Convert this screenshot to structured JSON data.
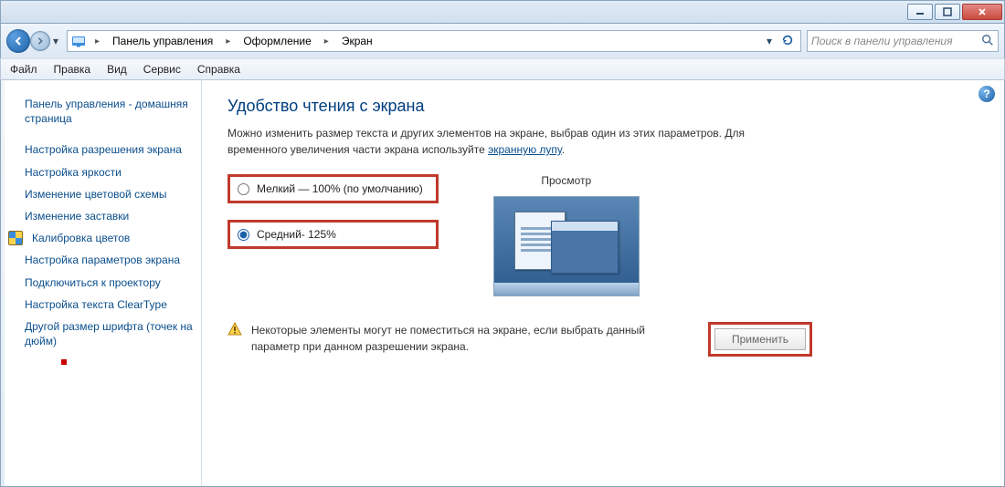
{
  "window": {
    "min_tooltip": "Свернуть",
    "max_tooltip": "Развернуть",
    "close_tooltip": "Закрыть"
  },
  "breadcrumb": {
    "items": [
      "Панель управления",
      "Оформление",
      "Экран"
    ]
  },
  "search": {
    "placeholder": "Поиск в панели управления"
  },
  "menu": {
    "file": "Файл",
    "edit": "Правка",
    "view": "Вид",
    "tools": "Сервис",
    "help": "Справка"
  },
  "sidebar": {
    "items": [
      {
        "label": "Панель управления - домашняя страница",
        "shield": false
      },
      {
        "label": "Настройка разрешения экрана",
        "shield": false
      },
      {
        "label": "Настройка яркости",
        "shield": false
      },
      {
        "label": "Изменение цветовой схемы",
        "shield": false
      },
      {
        "label": "Изменение заставки",
        "shield": false
      },
      {
        "label": "Калибровка цветов",
        "shield": true
      },
      {
        "label": "Настройка параметров экрана",
        "shield": false
      },
      {
        "label": "Подключиться к проектору",
        "shield": false
      },
      {
        "label": "Настройка текста ClearType",
        "shield": false
      },
      {
        "label": "Другой размер шрифта (точек на дюйм)",
        "shield": false
      }
    ]
  },
  "content": {
    "heading": "Удобство чтения с экрана",
    "desc_before_link": "Можно изменить размер текста и других элементов на экране, выбрав один из этих параметров. Для временного увеличения части экрана используйте ",
    "desc_link": "экранную лупу",
    "desc_after_link": ".",
    "radio_small": "Мелкий — 100% (по умолчанию)",
    "radio_medium": "Средний- 125%",
    "preview_title": "Просмотр",
    "warning_text": "Некоторые элементы могут не поместиться на экране, если выбрать данный параметр при данном разрешении экрана.",
    "apply_label": "Применить"
  }
}
